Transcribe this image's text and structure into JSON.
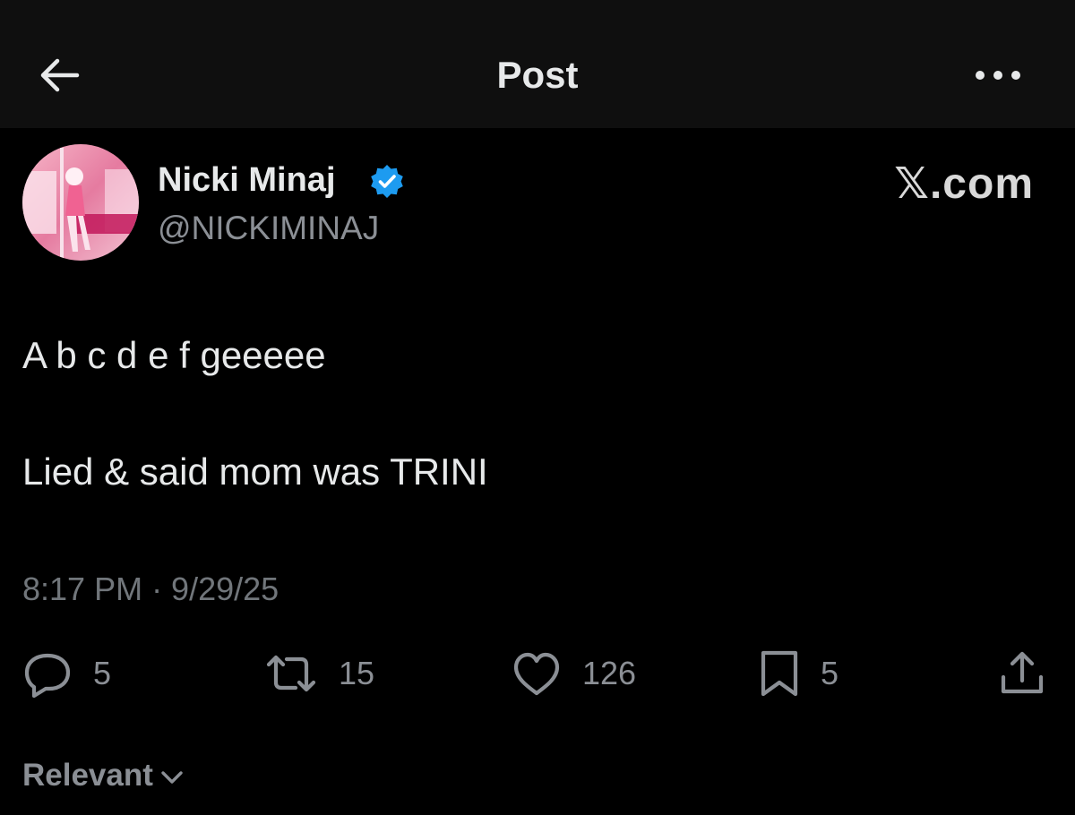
{
  "header": {
    "title": "Post",
    "back_icon": "arrow-left-icon",
    "more_icon": "more-horizontal-icon"
  },
  "author": {
    "display_name": "Nicki Minaj",
    "handle": "@NICKIMINAJ",
    "verified": true,
    "verified_color": "#1d9bf0"
  },
  "brand": "𝕏.com",
  "post": {
    "lines": [
      "A b c d e f geeeee",
      "Lied & said mom was TRINI"
    ],
    "timestamp": "8:17 PM · 9/29/25"
  },
  "actions": {
    "reply": {
      "icon": "reply-icon",
      "count": "5"
    },
    "repost": {
      "icon": "repost-icon",
      "count": "15"
    },
    "like": {
      "icon": "heart-icon",
      "count": "126"
    },
    "bookmark": {
      "icon": "bookmark-icon",
      "count": "5"
    },
    "share": {
      "icon": "share-icon"
    }
  },
  "replies_sort": {
    "label": "Relevant",
    "icon": "chevron-down-icon"
  },
  "colors": {
    "background": "#000000",
    "header_background": "#0f0f0f",
    "primary_text": "#e7e9ea",
    "secondary_text": "#71767b"
  }
}
